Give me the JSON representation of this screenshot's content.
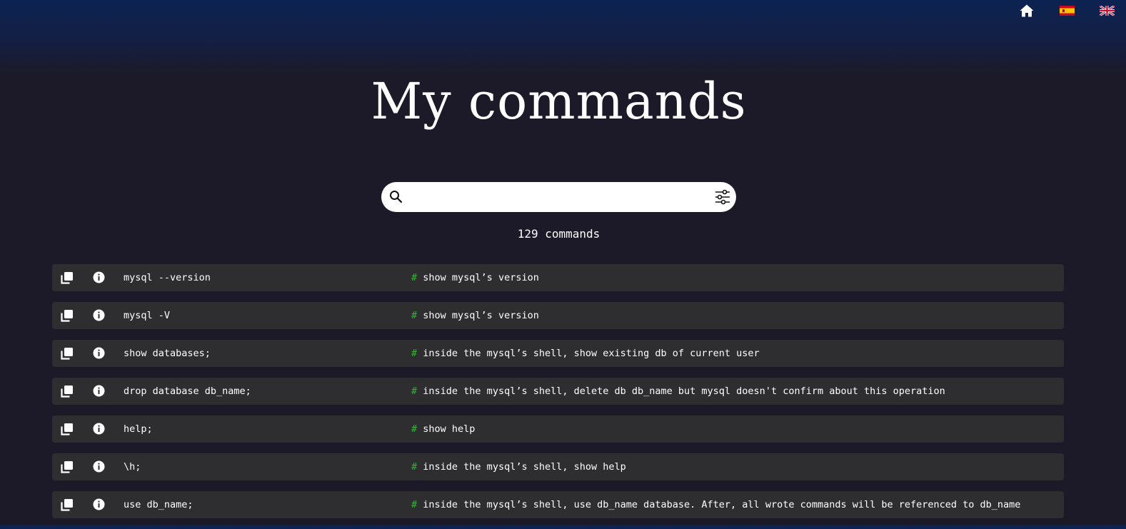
{
  "page": {
    "title": "My commands"
  },
  "nav": {
    "home_icon": "home-icon",
    "spanish_flag_icon": "spain-flag-icon",
    "english_flag_icon": "uk-flag-icon"
  },
  "search": {
    "value": "",
    "placeholder": "",
    "search_icon": "search-icon",
    "filter_icon": "sliders-icon"
  },
  "count_text": "129 commands",
  "comment_marker": "#",
  "commands": [
    {
      "command": "mysql --version",
      "comment": "show mysql’s version"
    },
    {
      "command": "mysql -V",
      "comment": "show mysql’s version"
    },
    {
      "command": "show databases;",
      "comment": "inside the mysql’s shell, show existing db of current user"
    },
    {
      "command": "drop database db_name;",
      "comment": "inside the mysql’s shell, delete db db_name but mysql doesn't confirm about this operation"
    },
    {
      "command": "help;",
      "comment": "show help"
    },
    {
      "command": "\\h;",
      "comment": "inside the mysql’s shell, show help"
    },
    {
      "command": "use db_name;",
      "comment": "inside the mysql’s shell, use db_name database. After, all wrote commands will be referenced to db_name"
    }
  ],
  "colors": {
    "header_gradient_top": "#0c2352",
    "background": "#1c1a28",
    "row_background": "#2e2e31",
    "comment_hash": "#2fb52f",
    "text": "#ffffff"
  }
}
